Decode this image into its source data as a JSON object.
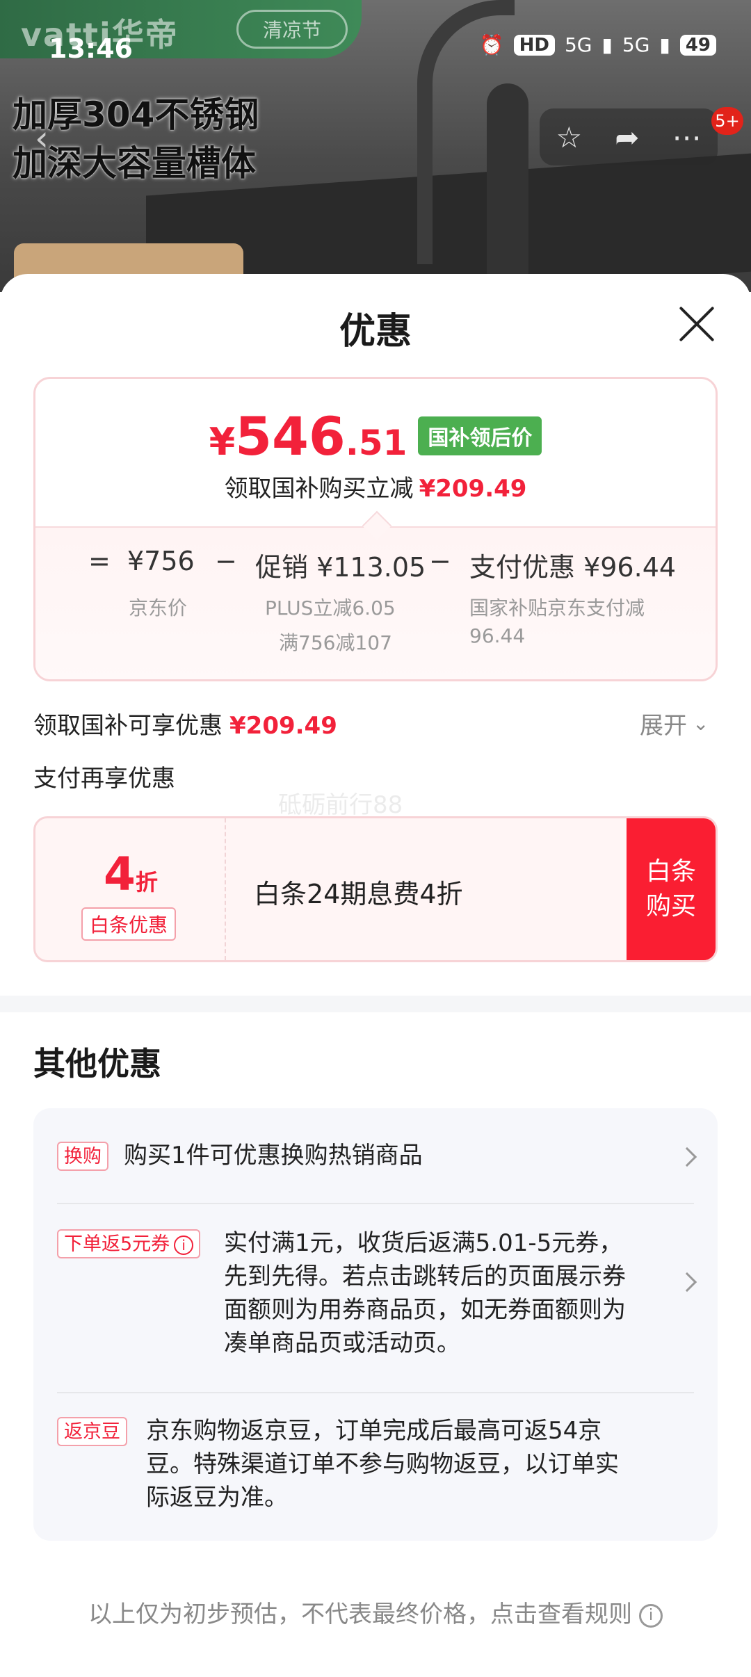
{
  "status_bar": {
    "time": "13:46",
    "hd": "HD",
    "net1": "5G",
    "net2": "5G",
    "battery": "49"
  },
  "hero": {
    "brand": "vatti华帝",
    "event": "清凉节",
    "headline_1": "加厚304不锈钢",
    "headline_2": "加深大容量槽体",
    "cart_badge": "5+"
  },
  "sheet": {
    "title": "优惠",
    "price": {
      "yen": "¥",
      "int": "546",
      "dec": ".51",
      "tag": "国补领后价"
    },
    "discount_line": {
      "label": "领取国补购买立减",
      "amount": "¥209.49"
    },
    "formula": {
      "eq": "=",
      "jd_price": "¥756",
      "minus1": "−",
      "promo": "促销 ¥113.05",
      "minus2": "−",
      "pay": "支付优惠 ¥96.44",
      "jd_label": "京东价",
      "promo_detail_1": "PLUS立减6.05",
      "promo_detail_2": "满756减107",
      "pay_detail_1": "国家补贴京东支付减",
      "pay_detail_2": "96.44"
    },
    "gov_row": {
      "label": "领取国补可享优惠",
      "amount": "¥209.49",
      "expand": "展开"
    },
    "pay_row": {
      "label": "支付再享优惠"
    },
    "watermark": "砥砺前行88",
    "baitiao": {
      "rate": "4",
      "unit": "折",
      "tag": "白条优惠",
      "desc": "白条24期息费4折",
      "btn_1": "白条",
      "btn_2": "购买"
    },
    "other": {
      "title": "其他优惠",
      "items": [
        {
          "tag": "换购",
          "text": "购买1件可优惠换购热销商品"
        },
        {
          "tag": "下单返5元券",
          "lines": [
            "实付满1元，收货后返满5.01-5元券，",
            "先到先得。若点击跳转后的页面展示券",
            "面额则为用券商品页，如无券面额则为",
            "凑单商品页或活动页。"
          ]
        },
        {
          "tag": "返京豆",
          "lines": [
            "京东购物返京豆，订单完成后最高可返54京",
            "豆。特殊渠道订单不参与购物返豆，以订单实",
            "际返豆为准。"
          ]
        }
      ]
    },
    "footnote": "以上仅为初步预估，不代表最终价格，点击查看规则"
  }
}
